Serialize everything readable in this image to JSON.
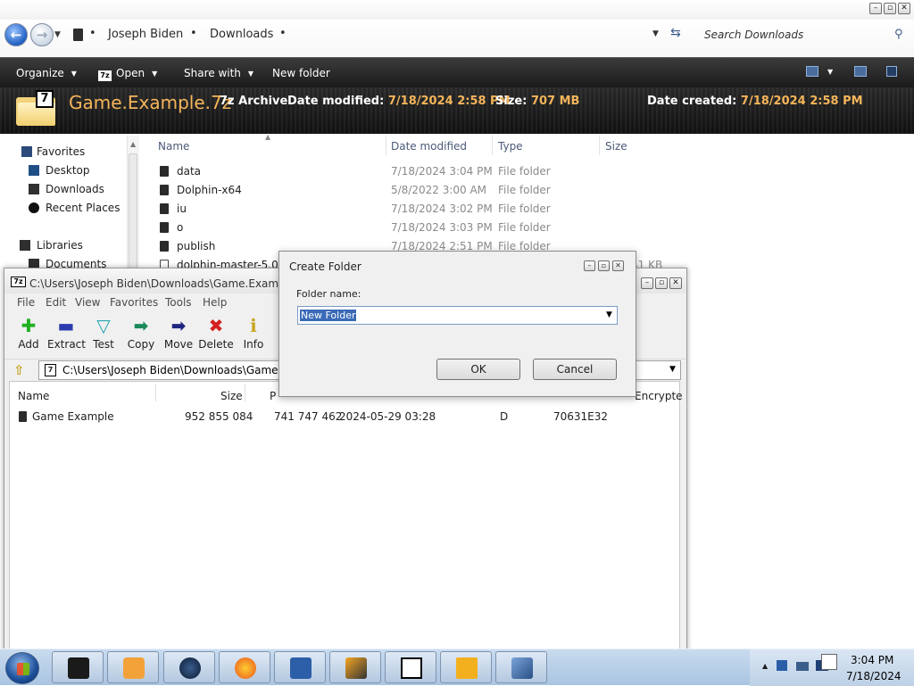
{
  "explorer": {
    "breadcrumb": [
      "Joseph Biden",
      "Downloads"
    ],
    "search_placeholder": "Search Downloads",
    "toolbar": {
      "organize": "Organize",
      "open": "Open",
      "share_with": "Share with",
      "new_folder": "New folder"
    },
    "details": {
      "file_name": "Game.Example.7z",
      "file_type": "7z Archive",
      "date_modified_label": "Date modified:",
      "date_modified": "7/18/2024 2:58 PM",
      "size_label": "Size:",
      "size": "707 MB",
      "date_created_label": "Date created:",
      "date_created": "7/18/2024 2:58 PM"
    },
    "nav": {
      "favorites": "Favorites",
      "desktop": "Desktop",
      "downloads": "Downloads",
      "recent": "Recent Places",
      "libraries": "Libraries",
      "documents": "Documents"
    },
    "columns": [
      "Name",
      "Date modified",
      "Type",
      "Size"
    ],
    "files": [
      {
        "name": "data",
        "date": "7/18/2024 3:04 PM",
        "type": "File folder"
      },
      {
        "name": "Dolphin-x64",
        "date": "5/8/2022 3:00 AM",
        "type": "File folder"
      },
      {
        "name": "iu",
        "date": "7/18/2024 3:02 PM",
        "type": "File folder"
      },
      {
        "name": "o",
        "date": "7/18/2024 3:03 PM",
        "type": "File folder"
      },
      {
        "name": "publish",
        "date": "7/18/2024 2:51 PM",
        "type": "File folder"
      }
    ],
    "partial_row": {
      "name": "dolphin-master-5.0-1",
      "size": "41 KB"
    }
  },
  "sevenzip": {
    "title": "C:\\Users\\Joseph Biden\\Downloads\\Game.Example.7z",
    "menu": [
      "File",
      "Edit",
      "View",
      "Favorites",
      "Tools",
      "Help"
    ],
    "tools": [
      "Add",
      "Extract",
      "Test",
      "Copy",
      "Move",
      "Delete",
      "Info"
    ],
    "path": "C:\\Users\\Joseph Biden\\Downloads\\Game.Exam",
    "columns": {
      "name": "Name",
      "size": "Size",
      "packed": "P",
      "encrypted": "Encrypte"
    },
    "row": {
      "name": "Game Example",
      "size": "952 855 084",
      "packed": "741 747 462",
      "modified": "2024-05-29 03:28",
      "attributes": "D",
      "crc": "70631E32"
    }
  },
  "dialog": {
    "title": "Create Folder",
    "field_label": "Folder name:",
    "value": "New Folder",
    "ok": "OK",
    "cancel": "Cancel"
  },
  "taskbar": {
    "time": "3:04 PM",
    "date": "7/18/2024",
    "apps": [
      "terminal",
      "media-player",
      "globe",
      "firefox",
      "virtualbox",
      "dolphin",
      "7-zip",
      "dolphin-emulator-de",
      "network-app"
    ]
  }
}
